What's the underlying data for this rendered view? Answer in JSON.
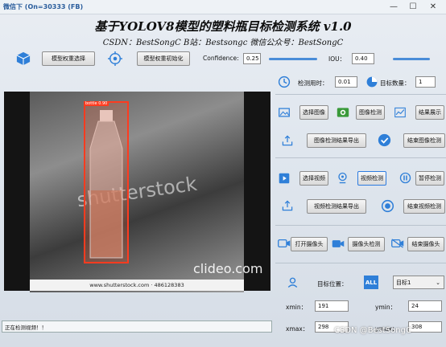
{
  "window": {
    "title": "微信下 (On=30333 (FB)",
    "minimize": "—",
    "maximize": "☐",
    "close": "✕"
  },
  "header": {
    "title": "基于YOLOV8模型的塑料瓶目标检测系统 v1.0",
    "subtitle": "CSDN：BestSongC   B站：Bestsongc   微信公众号：BestSongC"
  },
  "toolbar": {
    "weight_select": "模型权重选择",
    "weight_init": "模型权重初始化",
    "confidence_label": "Confidence:",
    "confidence_value": "0.25",
    "iou_label": "IOU：",
    "iou_value": "0.40"
  },
  "stats": {
    "time_label": "检测用时：",
    "time_value": "0.01",
    "count_label": "目标数量：",
    "count_value": "1"
  },
  "image": {
    "select": "选择图像",
    "detect": "图像检测",
    "show": "结果展示",
    "export": "图像检测结果导出",
    "end": "结束图像检测"
  },
  "video": {
    "select": "选择视频",
    "detect": "视频检测",
    "pause": "暂停检测",
    "export": "视频检测结果导出",
    "end": "结束视频检测"
  },
  "camera": {
    "open": "打开摄像头",
    "detect": "摄像头检测",
    "end": "结束摄像头"
  },
  "target": {
    "position_label": "目标位置：",
    "select_value": "目标1",
    "xmin_label": "xmin：",
    "xmin_value": "191",
    "ymin_label": "ymin：",
    "ymin_value": "24",
    "xmax_label": "xmax：",
    "xmax_value": "298",
    "ymax_label": "ymax：",
    "ymax_value": "308"
  },
  "display": {
    "bbox_label": "bottle 0.90",
    "watermark": "shutterstock",
    "clideo": "clideo.com",
    "caption": "www.shutterstock.com · 486128383"
  },
  "status": "正在检测视频！！",
  "overlay": "CSDN @BestSongC",
  "colors": {
    "accent": "#2d7be0",
    "bbox": "#ff3b1f"
  }
}
